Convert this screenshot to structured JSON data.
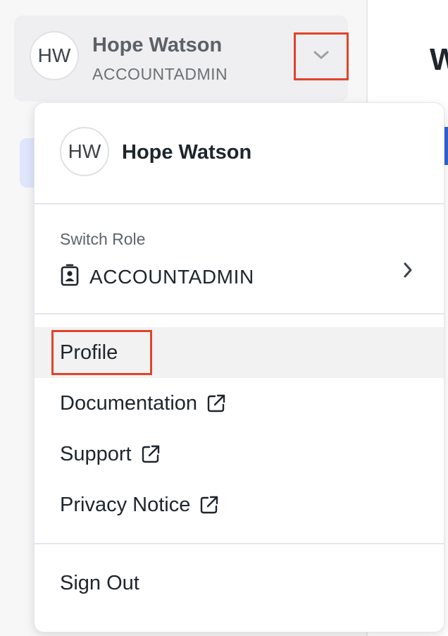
{
  "user_card": {
    "initials": "HW",
    "name": "Hope Watson",
    "role": "ACCOUNTADMIN"
  },
  "main": {
    "heading": "W"
  },
  "menu": {
    "initials": "HW",
    "name": "Hope Watson",
    "switch_role_label": "Switch Role",
    "current_role": "ACCOUNTADMIN",
    "items": [
      {
        "label": "Profile",
        "external": false
      },
      {
        "label": "Documentation",
        "external": true
      },
      {
        "label": "Support",
        "external": true
      },
      {
        "label": "Privacy Notice",
        "external": true
      }
    ],
    "sign_out_label": "Sign Out"
  },
  "colors": {
    "highlight_outline": "#e0442c",
    "accent": "#2f63d8"
  },
  "icons": {
    "chevron_down": "chevron-down-icon",
    "chevron_right": "chevron-right-icon",
    "role_badge": "id-badge-icon",
    "external_link": "external-link-icon"
  }
}
